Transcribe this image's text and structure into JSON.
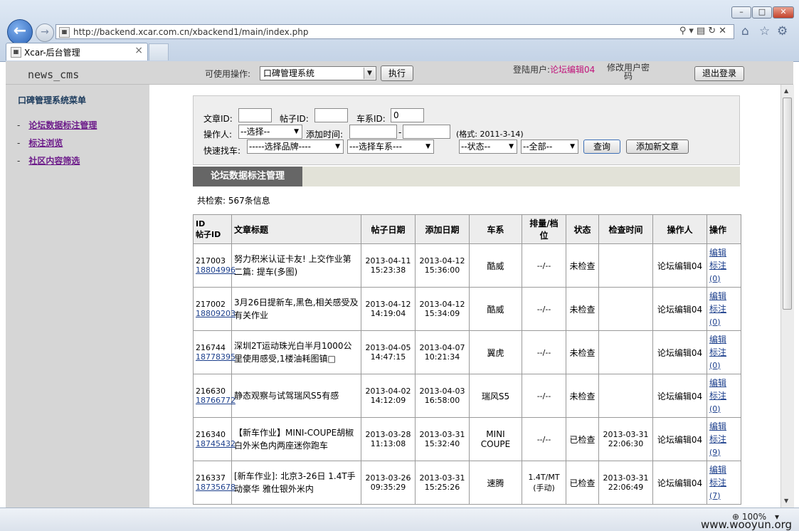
{
  "browser": {
    "url": "http://backend.xcar.com.cn/xbackend1/main/index.php",
    "tab_title": "Xcar-后台管理",
    "zoom": "100%",
    "watermark": "www.wooyun.org"
  },
  "header": {
    "logo": "news_cms",
    "ops_label": "可使用操作:",
    "ops_selected": "口碑管理系统",
    "exec_label": "执行",
    "user_prefix": "登陆用户:",
    "user_name": "论坛编辑04",
    "change_pwd_1": "修改用户密",
    "change_pwd_2": "码",
    "logout_label": "退出登录"
  },
  "menu": {
    "title": "口碑管理系统菜单",
    "items": [
      {
        "label": "论坛数据标注管理"
      },
      {
        "label": "标注浏览"
      },
      {
        "label": "社区内容筛选"
      }
    ]
  },
  "search": {
    "article_id_label": "文章ID:",
    "article_id_value": "",
    "post_id_label": "帖子ID:",
    "post_id_value": "",
    "series_id_label": "车系ID:",
    "series_id_value": "0",
    "operator_label": "操作人:",
    "operator_selected": "--选择--",
    "add_time_label": "添加时间:",
    "date_sep": "-",
    "format_hint": "(格式: 2011-3-14)",
    "quick_find_label": "快速找车:",
    "brand_selected": "-----选择品牌----",
    "series_selected": "---选择车系---",
    "status_selected": "--状态--",
    "all_selected": "--全部--",
    "query_label": "查询",
    "add_article_label": "添加新文章"
  },
  "section": {
    "tab_label": "论坛数据标注管理",
    "count_text": "共检索: 567条信息"
  },
  "table": {
    "headers": {
      "id_line1": "ID",
      "id_line2": "帖子ID",
      "title": "文章标题",
      "post_date": "帖子日期",
      "add_date": "添加日期",
      "series": "车系",
      "displacement_line1": "排量/档",
      "displacement_line2": "位",
      "status": "状态",
      "check_time": "检查时间",
      "operator": "操作人",
      "action": "操作"
    },
    "rows": [
      {
        "id": "217003",
        "post_id": "18804996",
        "title": "努力积米认证卡友! 上交作业第二篇: 提车(多图)",
        "post_date": "2013-04-11",
        "post_time": "15:23:38",
        "add_date": "2013-04-12",
        "add_time": "15:36:00",
        "series": "酷威",
        "disp1": "--/--",
        "disp2": "",
        "status": "未检查",
        "check_date": "",
        "check_time": "",
        "operator": "论坛编辑04",
        "edit": "编辑",
        "tag": "标注",
        "tag_count": "(0)"
      },
      {
        "id": "217002",
        "post_id": "18809203",
        "title": "3月26日提新车,黑色,相关感受及有关作业",
        "post_date": "2013-04-12",
        "post_time": "14:19:04",
        "add_date": "2013-04-12",
        "add_time": "15:34:09",
        "series": "酷威",
        "disp1": "--/--",
        "disp2": "",
        "status": "未检查",
        "check_date": "",
        "check_time": "",
        "operator": "论坛编辑04",
        "edit": "编辑",
        "tag": "标注",
        "tag_count": "(0)"
      },
      {
        "id": "216744",
        "post_id": "18778395",
        "title": "深圳2T运动珠光白半月1000公里使用感受,1楼油耗图镇□",
        "post_date": "2013-04-05",
        "post_time": "14:47:15",
        "add_date": "2013-04-07",
        "add_time": "10:21:34",
        "series": "翼虎",
        "disp1": "--/--",
        "disp2": "",
        "status": "未检查",
        "check_date": "",
        "check_time": "",
        "operator": "论坛编辑04",
        "edit": "编辑",
        "tag": "标注",
        "tag_count": "(0)"
      },
      {
        "id": "216630",
        "post_id": "18766772",
        "title": "静态观察与试驾瑞风S5有感",
        "post_date": "2013-04-02",
        "post_time": "14:12:09",
        "add_date": "2013-04-03",
        "add_time": "16:58:00",
        "series": "瑞风S5",
        "disp1": "--/--",
        "disp2": "",
        "status": "未检查",
        "check_date": "",
        "check_time": "",
        "operator": "论坛编辑04",
        "edit": "编辑",
        "tag": "标注",
        "tag_count": "(0)"
      },
      {
        "id": "216340",
        "post_id": "18745432",
        "title": "【新车作业】MINI-COUPE胡椒白外米色内两座迷你跑车",
        "post_date": "2013-03-28",
        "post_time": "11:13:08",
        "add_date": "2013-03-31",
        "add_time": "15:32:40",
        "series": "MINI COUPE",
        "disp1": "--/--",
        "disp2": "",
        "status": "已检查",
        "check_date": "2013-03-31",
        "check_time": "22:06:30",
        "operator": "论坛编辑04",
        "edit": "编辑",
        "tag": "标注",
        "tag_count": "(9)"
      },
      {
        "id": "216337",
        "post_id": "18735678",
        "title": "[新车作业]: 北京3-26日 1.4T手动豪华 雅仕银外米内",
        "post_date": "2013-03-26",
        "post_time": "09:35:29",
        "add_date": "2013-03-31",
        "add_time": "15:25:26",
        "series": "速腾",
        "disp1": "1.4T/MT",
        "disp2": "(手动)",
        "status": "已检查",
        "check_date": "2013-03-31",
        "check_time": "22:06:49",
        "operator": "论坛编辑04",
        "edit": "编辑",
        "tag": "标注",
        "tag_count": "(7)"
      }
    ]
  }
}
